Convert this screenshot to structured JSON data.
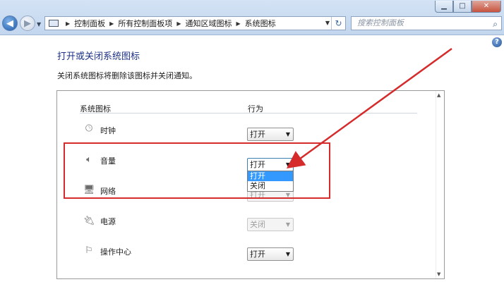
{
  "window": {
    "minimize_glyph": "▁",
    "maximize_glyph": "□",
    "close_glyph": "✕"
  },
  "nav": {
    "back_glyph": "◀",
    "forward_glyph": "▶",
    "history_glyph": "▼"
  },
  "address": {
    "breadcrumbs": [
      "控制面板",
      "所有控制面板项",
      "通知区域图标",
      "系统图标"
    ],
    "separator": "▶",
    "dropdown_glyph": "▼",
    "refresh_glyph": "↻"
  },
  "search": {
    "placeholder": "搜索控制面板",
    "icon": "search-icon"
  },
  "help": {
    "glyph": "?"
  },
  "page": {
    "title": "打开或关闭系统图标",
    "description": "关闭系统图标将删除该图标并关闭通知。"
  },
  "table": {
    "col_icon_header": "系统图标",
    "col_behavior_header": "行为",
    "rows": [
      {
        "label": "时钟",
        "icon": "clock-icon",
        "value": "打开",
        "disabled": false
      },
      {
        "label": "音量",
        "icon": "volume-icon",
        "value": "打开",
        "disabled": false
      },
      {
        "label": "网络",
        "icon": "network-icon",
        "value": "打开",
        "disabled": true
      },
      {
        "label": "电源",
        "icon": "power-icon",
        "value": "关闭",
        "disabled": true
      },
      {
        "label": "操作中心",
        "icon": "action-center-flag-icon",
        "value": "打开",
        "disabled": false
      }
    ],
    "open_dropdown_options": [
      "打开",
      "关闭"
    ],
    "open_dropdown_selected": "打开"
  },
  "colors": {
    "annotation": "#d52b2b",
    "title_blue": "#1e3287",
    "selection": "#3399ff"
  }
}
